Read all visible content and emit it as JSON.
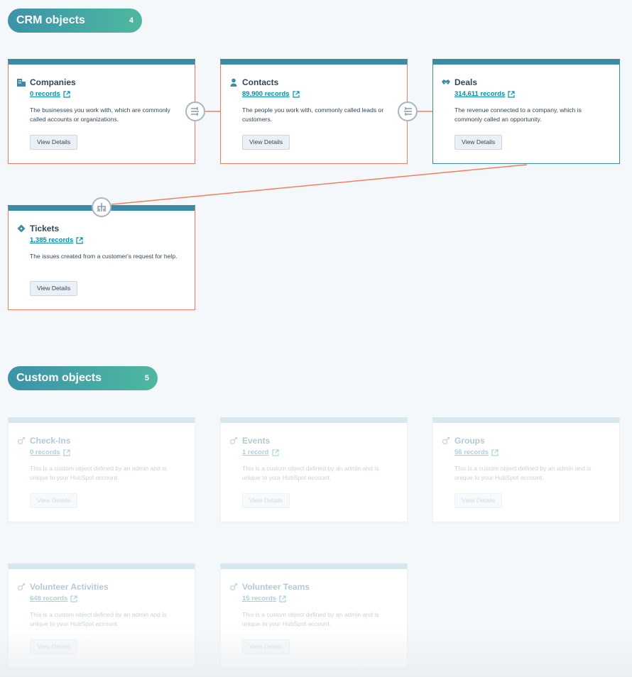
{
  "crm_section": {
    "title": "CRM objects",
    "count": "4"
  },
  "custom_section": {
    "title": "Custom objects",
    "count": "5"
  },
  "crm_objects": [
    {
      "name": "Companies",
      "records": "0 records",
      "description": "The businesses you work with, which are commonly called accounts or organizations.",
      "button": "View Details",
      "icon": "building-icon"
    },
    {
      "name": "Contacts",
      "records": "89,900 records",
      "description": "The people you work with, commonly called leads or customers.",
      "button": "View Details",
      "icon": "person-icon"
    },
    {
      "name": "Deals",
      "records": "314,611 records",
      "description": "The revenue connected to a company, which is commonly called an opportunity.",
      "button": "View Details",
      "icon": "handshake-icon"
    },
    {
      "name": "Tickets",
      "records": "1,385 records",
      "description": "The issues created from a customer's request for help.",
      "button": "View Details",
      "icon": "ticket-icon"
    }
  ],
  "custom_objects": [
    {
      "name": "Check-Ins",
      "records": "0 records",
      "description": "This is a custom object defined by an admin and is unique to your HubSpot account.",
      "button": "View Details",
      "icon": "custom-object-icon"
    },
    {
      "name": "Events",
      "records": "1 record",
      "description": "This is a custom object defined by an admin and is unique to your HubSpot account.",
      "button": "View Details",
      "icon": "custom-object-icon"
    },
    {
      "name": "Groups",
      "records": "56 records",
      "description": "This is a custom object defined by an admin and is unique to your HubSpot account.",
      "button": "View Details",
      "icon": "custom-object-icon"
    },
    {
      "name": "Volunteer Activities",
      "records": "648 records",
      "description": "This is a custom object defined by an admin and is unique to your HubSpot account.",
      "button": "View Details",
      "icon": "custom-object-icon"
    },
    {
      "name": "Volunteer Teams",
      "records": "15 records",
      "description": "This is a custom object defined by an admin and is unique to your HubSpot account.",
      "button": "View Details",
      "icon": "custom-object-icon"
    }
  ],
  "colors": {
    "accent": "#3b8ba5",
    "association_line": "#f07e60",
    "link": "#0091ae"
  }
}
